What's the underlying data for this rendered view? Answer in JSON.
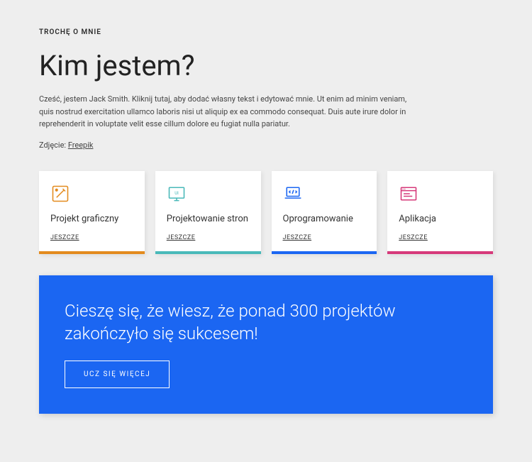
{
  "eyebrow": "TROCHĘ O MNIE",
  "heading": "Kim jestem?",
  "description": "Cześć, jestem Jack Smith. Kliknij tutaj, aby dodać własny tekst i edytować mnie. Ut enim ad minim veniam, quis nostrud exercitation ullamco laboris nisi ut aliquip ex ea commodo consequat. Duis aute irure dolor in reprehenderit in voluptate velit esse cillum dolore eu fugiat nulla pariatur.",
  "credit_prefix": "Zdjęcie: ",
  "credit_link": "Freepik",
  "cards": [
    {
      "title": "Projekt graficzny",
      "link": "JESZCZE",
      "color": "#e38b1e"
    },
    {
      "title": "Projektowanie stron",
      "link": "JESZCZE",
      "color": "#49b9b9"
    },
    {
      "title": "Oprogramowanie",
      "link": "JESZCZE",
      "color": "#1b66f2"
    },
    {
      "title": "Aplikacja",
      "link": "JESZCZE",
      "color": "#d6397a"
    }
  ],
  "banner": {
    "heading": "Cieszę się, że wiesz, że ponad 300 projektów zakończyło się sukcesem!",
    "button": "UCZ SIĘ WIĘCEJ"
  }
}
